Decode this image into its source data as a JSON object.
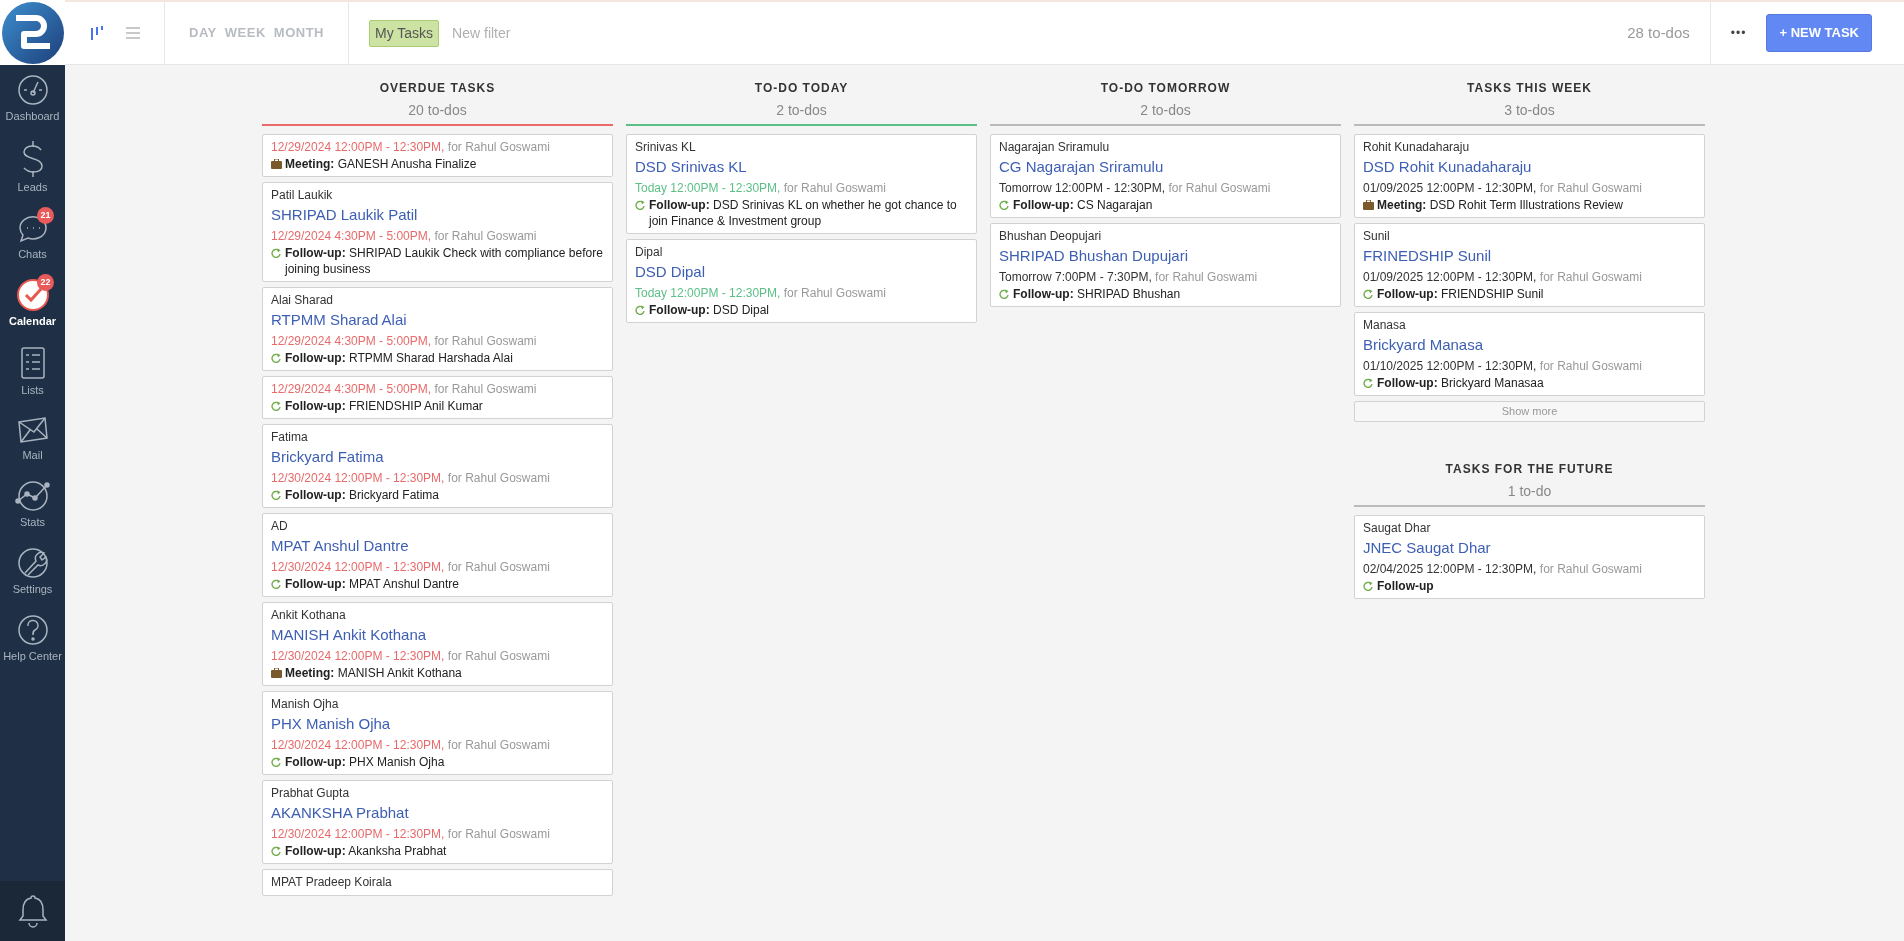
{
  "sidebar": {
    "items": [
      {
        "label": "Dashboard",
        "selected": false
      },
      {
        "label": "Leads",
        "selected": false
      },
      {
        "label": "Chats",
        "selected": false,
        "badge": "21"
      },
      {
        "label": "Calendar",
        "selected": true,
        "badge": "22"
      },
      {
        "label": "Lists",
        "selected": false
      },
      {
        "label": "Mail",
        "selected": false
      },
      {
        "label": "Stats",
        "selected": false
      },
      {
        "label": "Settings",
        "selected": false
      },
      {
        "label": "Help Center",
        "selected": false
      }
    ]
  },
  "toolbar": {
    "views": [
      {
        "selected": true
      },
      {
        "selected": false
      }
    ],
    "ranges": [
      {
        "label": "DAY",
        "selected": false
      },
      {
        "label": "WEEK",
        "selected": false
      },
      {
        "label": "MONTH",
        "selected": false
      }
    ],
    "filters": [
      {
        "label": "My Tasks",
        "selected": true
      },
      {
        "label": "New filter",
        "selected": false
      }
    ],
    "count": "28 to-dos",
    "more": "•••",
    "new_task": "+ NEW TASK"
  },
  "columns": [
    {
      "sections": [
        {
          "title": "OVERDUE TASKS",
          "count": "20 to-dos",
          "color": "#e86a6a",
          "tasks": [
            {
              "color": "#e86a6a",
              "when": "12/29/2024 12:00PM - 12:30PM,",
              "assignee": "for Rahul Goswami",
              "kind": "meeting",
              "label": "Meeting:",
              "text": "GANESH Anusha Finalize"
            },
            {
              "color": "#e86a6a",
              "contact": "Patil Laukik",
              "title": "SHRIPAD Laukik Patil",
              "when": "12/29/2024 4:30PM - 5:00PM,",
              "assignee": "for Rahul Goswami",
              "kind": "follow_up",
              "label": "Follow-up:",
              "text": "SHRIPAD Laukik Check with compliance before joining business"
            },
            {
              "color": "#e86a6a",
              "contact": "Alai Sharad",
              "title": "RTPMM Sharad Alai",
              "when": "12/29/2024 4:30PM - 5:00PM,",
              "assignee": "for Rahul Goswami",
              "kind": "follow_up",
              "label": "Follow-up:",
              "text": "RTPMM Sharad Harshada Alai"
            },
            {
              "color": "#e86a6a",
              "when": "12/29/2024 4:30PM - 5:00PM,",
              "assignee": "for Rahul Goswami",
              "kind": "follow_up",
              "label": "Follow-up:",
              "text": "FRIENDSHIP Anil Kumar"
            },
            {
              "color": "#e86a6a",
              "contact": "Fatima",
              "title": "Brickyard Fatima",
              "when": "12/30/2024 12:00PM - 12:30PM,",
              "assignee": "for Rahul Goswami",
              "kind": "follow_up",
              "label": "Follow-up:",
              "text": "Brickyard Fatima"
            },
            {
              "color": "#e86a6a",
              "contact": "AD",
              "title": "MPAT Anshul Dantre",
              "when": "12/30/2024 12:00PM - 12:30PM,",
              "assignee": "for Rahul Goswami",
              "kind": "follow_up",
              "label": "Follow-up:",
              "text": "MPAT Anshul Dantre"
            },
            {
              "color": "#e86a6a",
              "contact": "Ankit Kothana",
              "title": "MANISH Ankit Kothana",
              "when": "12/30/2024 12:00PM - 12:30PM,",
              "assignee": "for Rahul Goswami",
              "kind": "meeting",
              "label": "Meeting:",
              "text": "MANISH Ankit Kothana"
            },
            {
              "color": "#e86a6a",
              "contact": "Manish Ojha",
              "title": "PHX Manish Ojha",
              "when": "12/30/2024 12:00PM - 12:30PM,",
              "assignee": "for Rahul Goswami",
              "kind": "follow_up",
              "label": "Follow-up:",
              "text": "PHX Manish Ojha"
            },
            {
              "color": "#e86a6a",
              "contact": "Prabhat Gupta",
              "title": "AKANKSHA Prabhat",
              "when": "12/30/2024 12:00PM - 12:30PM,",
              "assignee": "for Rahul Goswami",
              "kind": "follow_up",
              "label": "Follow-up:",
              "text": "Akanksha Prabhat"
            },
            {
              "contact": "MPAT Pradeep Koirala"
            }
          ]
        }
      ]
    },
    {
      "sections": [
        {
          "title": "TO-DO TODAY",
          "count": "2 to-dos",
          "color": "#5cbf85",
          "tasks": [
            {
              "color": "#5cbf85",
              "contact": "Srinivas KL",
              "title": "DSD Srinivas KL",
              "when": "Today 12:00PM - 12:30PM,",
              "assignee": "for Rahul Goswami",
              "kind": "follow_up",
              "label": "Follow-up:",
              "text": "DSD Srinivas KL on whether he got chance to join Finance & Investment group"
            },
            {
              "color": "#5cbf85",
              "contact": "Dipal",
              "title": "DSD Dipal",
              "when": "Today 12:00PM - 12:30PM,",
              "assignee": "for Rahul Goswami",
              "kind": "follow_up",
              "label": "Follow-up:",
              "text": "DSD Dipal"
            }
          ]
        }
      ]
    },
    {
      "sections": [
        {
          "title": "TO-DO TOMORROW",
          "count": "2 to-dos",
          "color": "#bbbbbb",
          "tasks": [
            {
              "color": "#333333",
              "contact": "Nagarajan Sriramulu",
              "title": "CG Nagarajan Sriramulu",
              "when": "Tomorrow 12:00PM - 12:30PM,",
              "assignee": "for Rahul Goswami",
              "kind": "follow_up",
              "label": "Follow-up:",
              "text": "CS Nagarajan"
            },
            {
              "color": "#333333",
              "contact": "Bhushan Deopujari",
              "title": "SHRIPAD Bhushan Dupujari",
              "when": "Tomorrow 7:00PM - 7:30PM,",
              "assignee": "for Rahul Goswami",
              "kind": "follow_up",
              "label": "Follow-up:",
              "text": "SHRIPAD Bhushan"
            }
          ]
        }
      ]
    },
    {
      "sections": [
        {
          "title": "TASKS THIS WEEK",
          "count": "3 to-dos",
          "color": "#bbbbbb",
          "show_more": "Show more",
          "tasks": [
            {
              "color": "#333333",
              "contact": "Rohit Kunadaharaju",
              "title": "DSD Rohit Kunadaharaju",
              "when": "01/09/2025 12:00PM - 12:30PM,",
              "assignee": "for Rahul Goswami",
              "kind": "meeting",
              "label": "Meeting:",
              "text": "DSD Rohit Term Illustrations Review"
            },
            {
              "color": "#333333",
              "contact": "Sunil",
              "title": "FRINEDSHIP Sunil",
              "when": "01/09/2025 12:00PM - 12:30PM,",
              "assignee": "for Rahul Goswami",
              "kind": "follow_up",
              "label": "Follow-up:",
              "text": "FRIENDSHIP Sunil"
            },
            {
              "color": "#333333",
              "contact": "Manasa",
              "title": "Brickyard Manasa",
              "when": "01/10/2025 12:00PM - 12:30PM,",
              "assignee": "for Rahul Goswami",
              "kind": "follow_up",
              "label": "Follow-up:",
              "text": "Brickyard Manasaa"
            }
          ]
        },
        {
          "title": "TASKS FOR THE FUTURE",
          "count": "1 to-do",
          "color": "#bbbbbb",
          "tasks": [
            {
              "color": "#333333",
              "contact": "Saugat Dhar",
              "title": "JNEC Saugat Dhar",
              "when": "02/04/2025 12:00PM - 12:30PM,",
              "assignee": "for Rahul Goswami",
              "kind": "follow_up",
              "label": "Follow-up"
            }
          ]
        }
      ]
    }
  ]
}
